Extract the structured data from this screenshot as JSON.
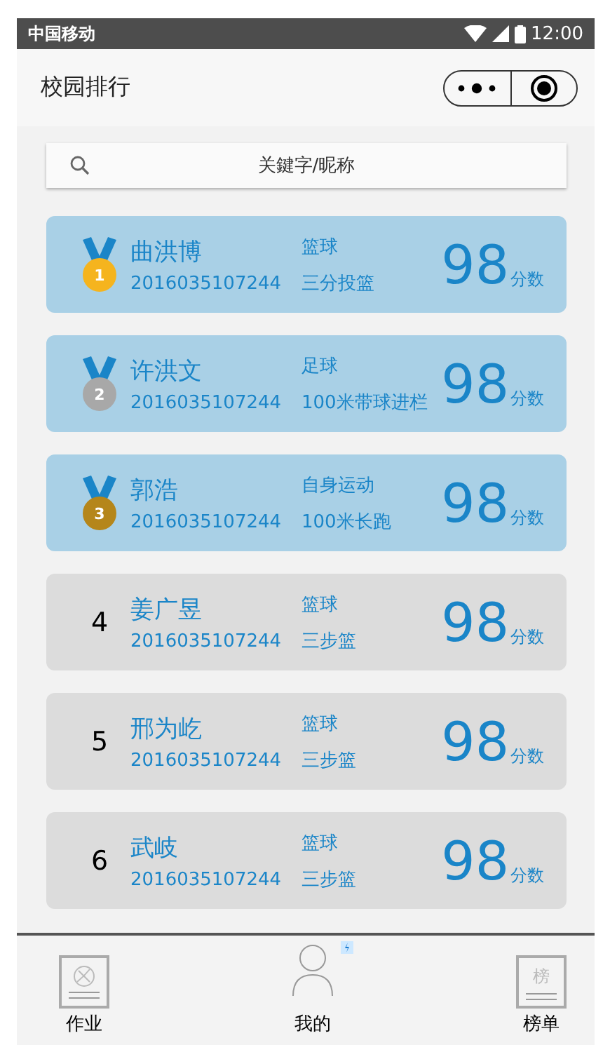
{
  "status_bar": {
    "carrier": "中国移动",
    "time": "12:00"
  },
  "header": {
    "title": "校园排行"
  },
  "search": {
    "placeholder": "关鍵字/昵称"
  },
  "rankings": [
    {
      "kind": "medal",
      "rank": "1",
      "color": "#f5b41e",
      "name": "曲洪博",
      "id": "2016035107244",
      "sport": "篮球",
      "event": "三分投篮",
      "score": "98",
      "unit": "分数"
    },
    {
      "kind": "medal",
      "rank": "2",
      "color": "#a8a8a8",
      "name": "许洪文",
      "id": "2016035107244",
      "sport": "足球",
      "event": "100米带球进栏",
      "score": "98",
      "unit": "分数"
    },
    {
      "kind": "medal",
      "rank": "3",
      "color": "#b5861a",
      "name": "郭浩",
      "id": "2016035107244",
      "sport": "自身运动",
      "event": "100米长跑",
      "score": "98",
      "unit": "分数"
    },
    {
      "kind": "number",
      "rank": "4",
      "name": "姜广昱",
      "id": "2016035107244",
      "sport": "篮球",
      "event": "三步篮",
      "score": "98",
      "unit": "分数"
    },
    {
      "kind": "number",
      "rank": "5",
      "name": "邢为屹",
      "id": "2016035107244",
      "sport": "篮球",
      "event": "三步篮",
      "score": "98",
      "unit": "分数"
    },
    {
      "kind": "number",
      "rank": "6",
      "name": "武岐",
      "id": "2016035107244",
      "sport": "篮球",
      "event": "三步篮",
      "score": "98",
      "unit": "分数"
    }
  ],
  "tab_bar": [
    {
      "kind": "homework",
      "label": "作业"
    },
    {
      "kind": "profile",
      "label": "我的"
    },
    {
      "kind": "board",
      "label": "榜单",
      "icon_text": "榜"
    }
  ]
}
